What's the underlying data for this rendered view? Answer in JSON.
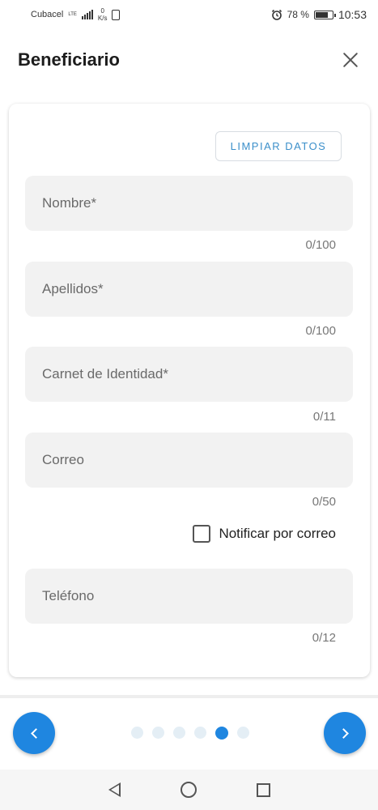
{
  "status_bar": {
    "carrier": "Cubacel",
    "network": "LTE",
    "speed_value": "0",
    "speed_unit": "K/s",
    "battery": "78 %",
    "battery_level": 0.78,
    "time": "10:53"
  },
  "header": {
    "title": "Beneficiario"
  },
  "form": {
    "clear_label": "LIMPIAR DATOS",
    "fields": [
      {
        "placeholder": "Nombre*",
        "counter": "0/100"
      },
      {
        "placeholder": "Apellidos*",
        "counter": "0/100"
      },
      {
        "placeholder": "Carnet de Identidad*",
        "counter": "0/11"
      },
      {
        "placeholder": "Correo",
        "counter": "0/50"
      },
      {
        "placeholder": "Teléfono",
        "counter": "0/12"
      }
    ],
    "notify_label": "Notificar por correo"
  },
  "pager": {
    "total": 6,
    "active_index": 4
  },
  "colors": {
    "accent": "#1f86e0",
    "field_bg": "#f2f2f2",
    "dot_inactive": "#e4eef5",
    "clear_text": "#3b8fca"
  }
}
